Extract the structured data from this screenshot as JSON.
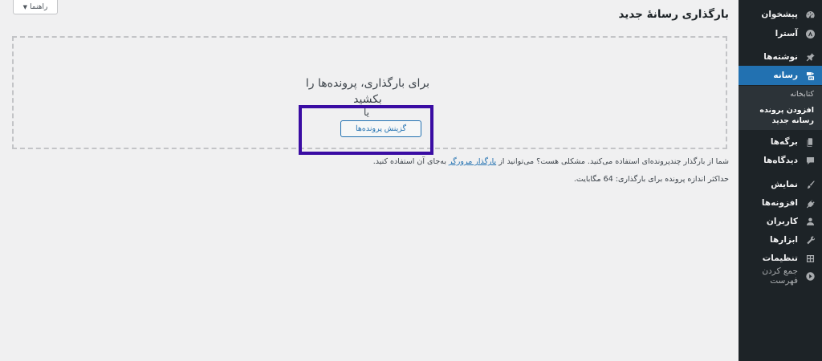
{
  "sidebar": {
    "items": [
      {
        "id": "dashboard",
        "label": "پیشخوان",
        "icon": "dashboard-icon"
      },
      {
        "id": "astra",
        "label": "آسترا",
        "icon": "astra-logo-icon"
      },
      {
        "id": "posts",
        "label": "نوشته‌ها",
        "icon": "pin-icon"
      },
      {
        "id": "media",
        "label": "رسانه",
        "icon": "media-icon",
        "active": true
      },
      {
        "id": "pages",
        "label": "برگه‌ها",
        "icon": "page-icon"
      },
      {
        "id": "comments",
        "label": "دیدگاه‌ها",
        "icon": "comment-icon"
      },
      {
        "id": "appearance",
        "label": "نمایش",
        "icon": "brush-icon"
      },
      {
        "id": "plugins",
        "label": "افزونه‌ها",
        "icon": "plug-icon"
      },
      {
        "id": "users",
        "label": "کاربران",
        "icon": "user-icon"
      },
      {
        "id": "tools",
        "label": "ابزارها",
        "icon": "wrench-icon"
      },
      {
        "id": "settings",
        "label": "تنظیمات",
        "icon": "settings-icon"
      }
    ],
    "submenu": {
      "library": "کتابخانه",
      "add_new": "افزودن پرونده رسانه جدید"
    },
    "collapse_label": "جمع کردن فهرست"
  },
  "header": {
    "help_label": "راهنما",
    "title": "بارگذاری رسانهٔ جدید"
  },
  "uploader": {
    "drop_text": "برای بارگذاری، پرونده‌ها را بکشید",
    "or_text": "یا",
    "select_button": "گزینش پرونده‌ها"
  },
  "info": {
    "multi_uploader_text": "شما از بارگذار چندپرونده‌ای استفاده می‌کنید. مشکلی هست؟ می‌توانید از",
    "browser_uploader_link": "بارگذار مرورگر",
    "multi_uploader_suffix": "به‌جای آن استفاده کنید.",
    "max_size_text": "حداکثر اندازه پرونده برای بارگذاری: 64 مگابایت."
  },
  "colors": {
    "sidebar_bg": "#1d2327",
    "active_bg": "#2271b1",
    "highlight": "#3a0ca3",
    "page_bg": "#f0f0f1"
  }
}
